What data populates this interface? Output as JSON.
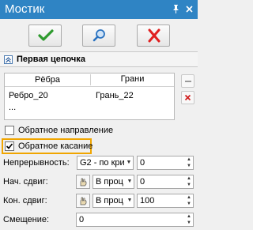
{
  "window": {
    "title": "Мостик",
    "pin_icon": "pin-icon",
    "close_icon": "close-icon"
  },
  "actions": {
    "ok_icon": "checkmark-icon",
    "preview_icon": "preview-search-icon",
    "cancel_icon": "cross-icon",
    "colors": {
      "ok": "#2e9a2e",
      "preview": "#2a72c0",
      "cancel": "#e02020"
    }
  },
  "section": {
    "label": "Первая цепочка",
    "collapse_icon": "chevron-up-icon"
  },
  "table": {
    "columns": [
      "Рёбра",
      "Грани"
    ],
    "rows": [
      [
        "Ребро_20",
        "Грань_22"
      ]
    ],
    "more": "..."
  },
  "options": {
    "reverse_direction": {
      "label": "Обратное направление",
      "checked": false
    },
    "reverse_tangency": {
      "label": "Обратное касание",
      "checked": true
    }
  },
  "fields": {
    "continuity": {
      "label": "Непрерывность:",
      "select": "G2 - по кри",
      "value": "0"
    },
    "start_shift": {
      "label": "Нач. сдвиг:",
      "select": "В проц",
      "value": "0"
    },
    "end_shift": {
      "label": "Кон. сдвиг:",
      "select": "В проц",
      "value": "100"
    },
    "offset": {
      "label": "Смещение:",
      "value": "0"
    }
  }
}
